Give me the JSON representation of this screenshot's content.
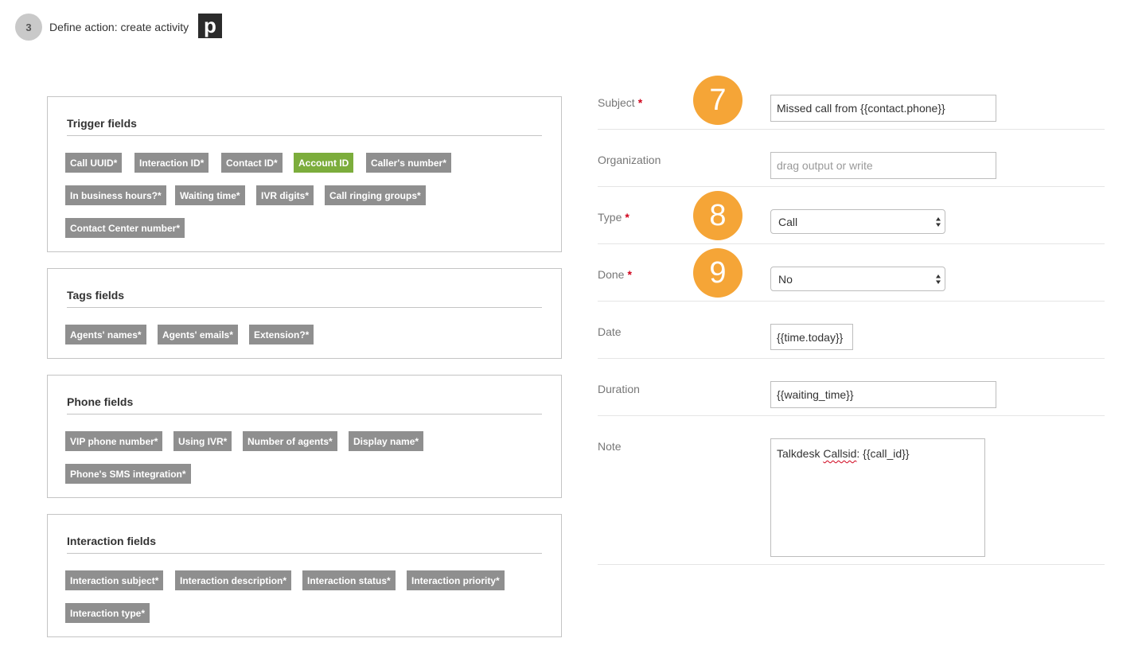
{
  "header": {
    "step_number": "3",
    "title": "Define action: create activity",
    "logo_letter": "p"
  },
  "panels": [
    {
      "title": "Trigger fields",
      "tags": [
        "Call UUID*",
        "Interaction ID*",
        "Contact ID*",
        "Account ID",
        "Caller's number*",
        "In business hours?*",
        "Waiting time*",
        "IVR digits*",
        "Call ringing groups*",
        "Contact Center number*"
      ]
    },
    {
      "title": "Tags fields",
      "tags": [
        "Agents' names*",
        "Agents' emails*",
        "Extension?*"
      ]
    },
    {
      "title": "Phone fields",
      "tags": [
        "VIP phone number*",
        "Using IVR*",
        "Number of agents*",
        "Display name*",
        "Phone's SMS integration*"
      ]
    },
    {
      "title": "Interaction fields",
      "tags": [
        "Interaction subject*",
        "Interaction description*",
        "Interaction status*",
        "Interaction priority*",
        "Interaction type*"
      ]
    }
  ],
  "active_tag_color": "#7cad3c",
  "tag_color": "#8f8f8f",
  "required_mark": "*",
  "form": {
    "subject": {
      "label": "Subject",
      "value": "Missed call from {{contact.phone}}"
    },
    "organization": {
      "label": "Organization",
      "placeholder": "drag output or write"
    },
    "type": {
      "label": "Type",
      "value": "Call"
    },
    "done": {
      "label": "Done",
      "value": "No"
    },
    "date": {
      "label": "Date",
      "value": "{{time.today}}"
    },
    "duration": {
      "label": "Duration",
      "value": "{{waiting_time}}"
    },
    "note": {
      "label": "Note",
      "value_prefix": "Talkdesk ",
      "value_misspelled": "Callsid",
      "value_suffix": ": {{call_id}}"
    }
  },
  "badges": [
    "7",
    "8",
    "9"
  ],
  "badge_color": "#f5a537"
}
